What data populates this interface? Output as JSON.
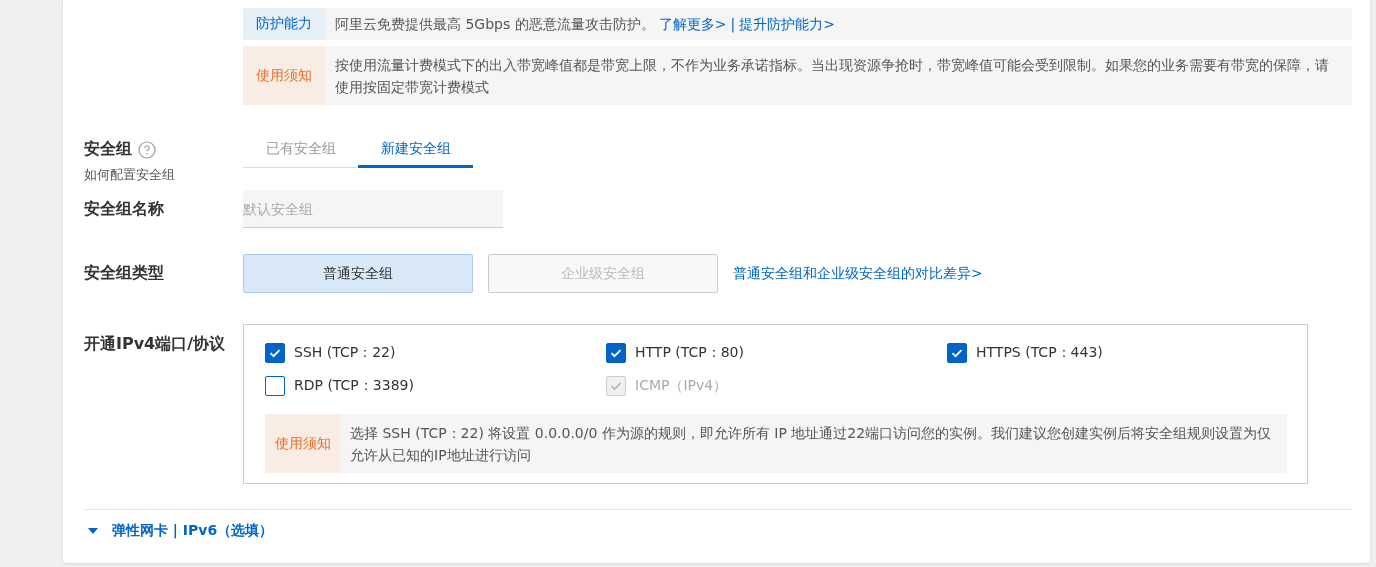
{
  "protection": {
    "label": "防护能力",
    "text": "阿里云免费提供最高 5Gbps 的恶意流量攻击防护。",
    "links": [
      "了解更多>",
      "提升防护能力>"
    ],
    "separator": "|"
  },
  "bandwidth_notice": {
    "label": "使用须知",
    "text": "按使用流量计费模式下的出入带宽峰值都是带宽上限，不作为业务承诺指标。当出现资源争抢时，带宽峰值可能会受到限制。如果您的业务需要有带宽的保障，请使用按固定带宽计费模式"
  },
  "security_group": {
    "label": "安全组",
    "help_link": "如何配置安全组",
    "tabs": [
      {
        "label": "已有安全组",
        "selected": false
      },
      {
        "label": "新建安全组",
        "selected": true
      }
    ]
  },
  "name_field": {
    "label": "安全组名称",
    "placeholder": "默认安全组"
  },
  "group_type": {
    "label": "安全组类型",
    "options": [
      {
        "label": "普通安全组",
        "selected": true,
        "disabled": false
      },
      {
        "label": "企业级安全组",
        "selected": false,
        "disabled": true
      }
    ],
    "compare_link": "普通安全组和企业级安全组的对比差异>"
  },
  "ports": {
    "label": "开通IPv4端口/协议",
    "options": [
      {
        "label": "SSH (TCP：22)",
        "checked": true,
        "disabled": false
      },
      {
        "label": "HTTP (TCP：80)",
        "checked": true,
        "disabled": false
      },
      {
        "label": "HTTPS (TCP：443)",
        "checked": true,
        "disabled": false
      },
      {
        "label": "RDP (TCP：3389)",
        "checked": false,
        "disabled": false
      },
      {
        "label": "ICMP（IPv4）",
        "checked": true,
        "disabled": true
      }
    ],
    "notice": {
      "label": "使用须知",
      "text": "选择 SSH (TCP：22) 将设置 0.0.0.0/0 作为源的规则，即允许所有 IP 地址通过22端口访问您的实例。我们建议您创建实例后将安全组规则设置为仅允许从已知的IP地址进行访问"
    }
  },
  "advanced": {
    "label": "弹性网卡 | IPv6（选填）",
    "expanded": false
  }
}
